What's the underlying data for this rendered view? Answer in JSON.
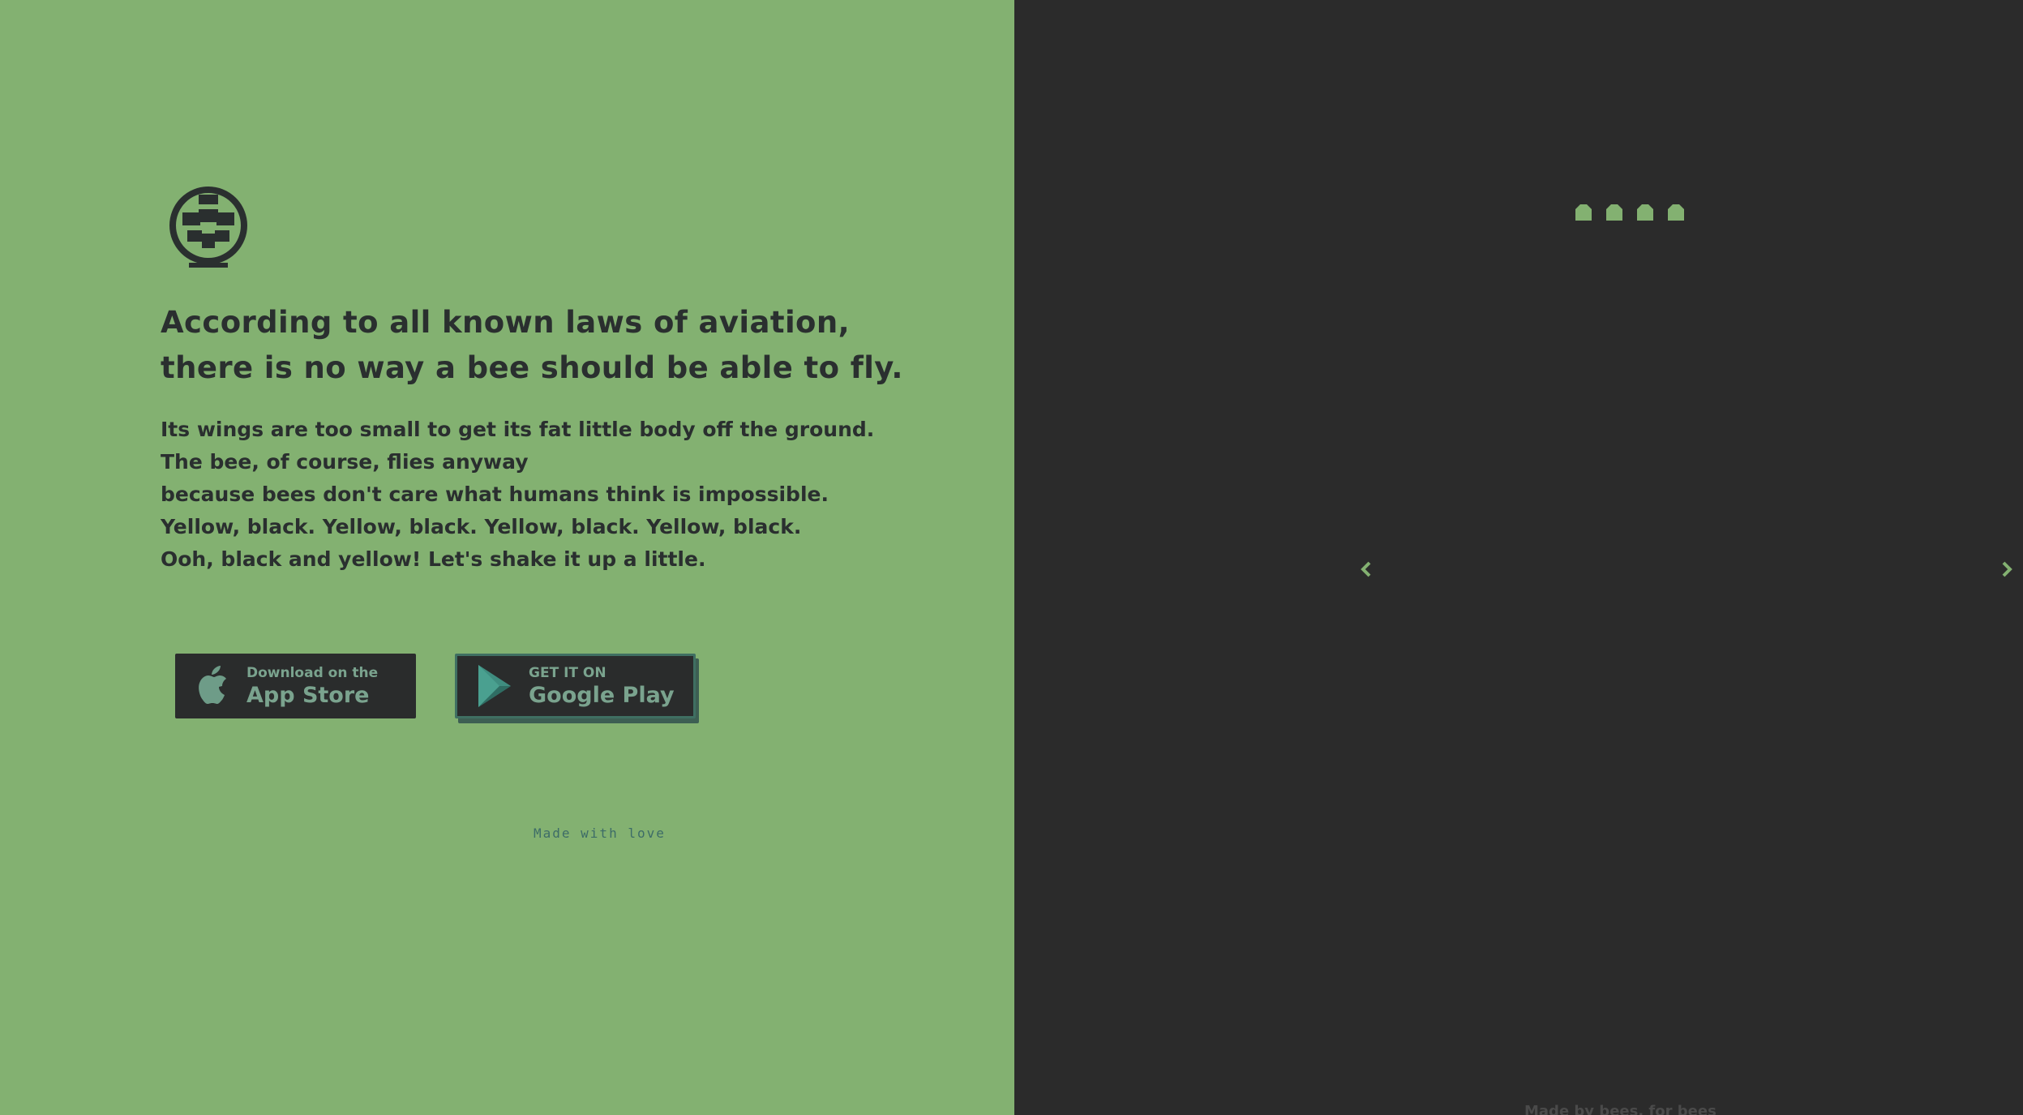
{
  "colors": {
    "left_background": "#83b171",
    "right_background": "#2b2b2b",
    "text_dark": "#2a2f2f",
    "accent_teal": "#3f6f62",
    "button_background": "#2a2c2c"
  },
  "brand": {
    "logo_icon": "bee-globe-logo-icon"
  },
  "hero": {
    "headline_line1": "According to all known laws of aviation,",
    "headline_line2": "there is no way a bee should be able to fly.",
    "body_lines": [
      "Its wings are too small to get its fat little body off the ground.",
      "The bee, of course, flies anyway",
      "because bees don't care what humans think is impossible.",
      "Yellow, black. Yellow, black. Yellow, black. Yellow, black.",
      "Ooh, black and yellow! Let's shake it up a little."
    ]
  },
  "downloads": {
    "apple": {
      "small": "Download on the",
      "big": "App Store",
      "icon": "apple-icon"
    },
    "google": {
      "small": "GET IT ON",
      "big": "Google Play",
      "icon": "google-play-icon"
    }
  },
  "tagline": "Made with love",
  "gallery": {
    "mini_icons": [
      "bee-icon",
      "bee-icon",
      "bee-icon",
      "bee-icon"
    ],
    "prev_icon": "chevron-left-icon",
    "next_icon": "chevron-right-icon"
  },
  "footer_note": "Made by bees, for bees"
}
